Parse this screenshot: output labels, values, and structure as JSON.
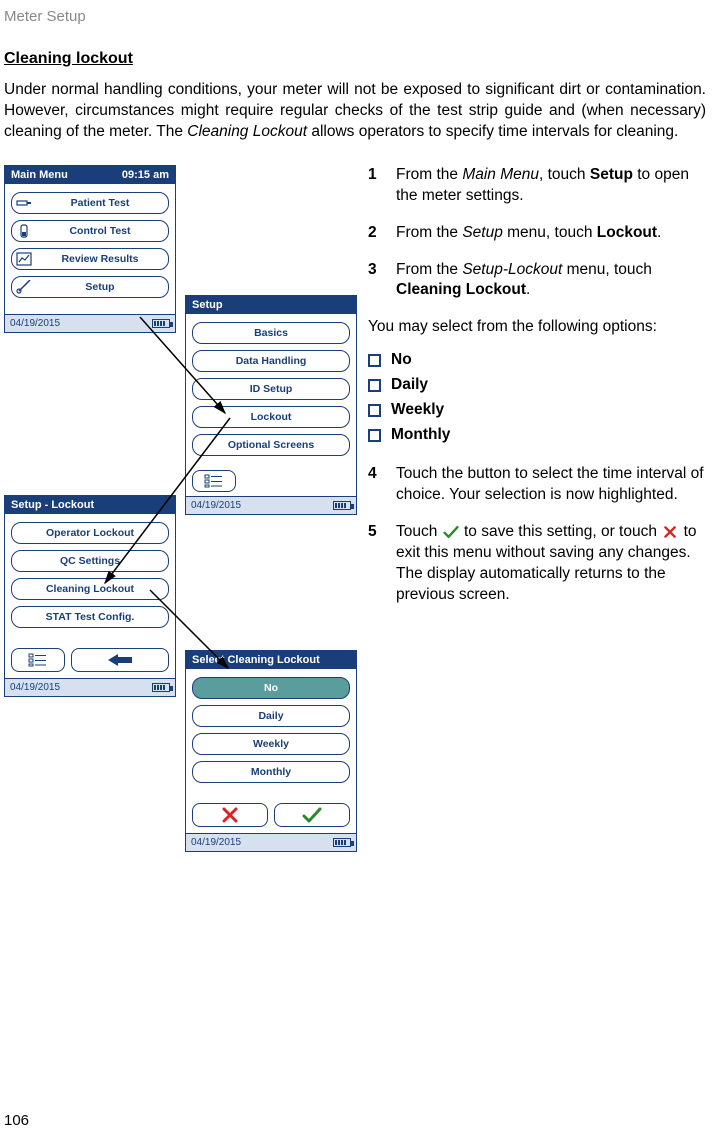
{
  "header": "Meter Setup",
  "section_title": "Cleaning lockout",
  "intro_html": "Under normal handling conditions, your meter will not be exposed to significant dirt or contamination. However, circumstances might require regular checks of the test strip guide and (when necessary) cleaning of the meter. The <em>Cleaning Lockout</em> allows operators to specify time intervals for cleaning.",
  "steps": [
    {
      "num": "1",
      "html": "From the <em>Main Menu</em>, touch <b>Setup</b> to open the meter settings."
    },
    {
      "num": "2",
      "html": "From the <em>Setup</em> menu, touch <b>Lockout</b>."
    },
    {
      "num": "3",
      "html": "From the <em>Setup-Lockout</em> menu, touch <b>Cleaning Lockout</b>."
    }
  ],
  "options_intro": "You may select from the following options:",
  "options": [
    "No",
    "Daily",
    "Weekly",
    "Monthly"
  ],
  "steps2": [
    {
      "num": "4",
      "html": "Touch the button to select the time interval of choice. Your selection is now highlighted."
    },
    {
      "num": "5",
      "html_pre": "Touch ",
      "html_mid": " to save this setting, or touch ",
      "html_post": " to exit this menu without saving any changes. The display automatically returns to the previous screen."
    }
  ],
  "screens": {
    "main": {
      "title": "Main Menu",
      "time": "09:15 am",
      "buttons": [
        "Patient Test",
        "Control Test",
        "Review Results",
        "Setup"
      ],
      "date": "04/19/2015"
    },
    "setup": {
      "title": "Setup",
      "buttons": [
        "Basics",
        "Data Handling",
        "ID Setup",
        "Lockout",
        "Optional Screens"
      ],
      "date": "04/19/2015"
    },
    "lockout": {
      "title": "Setup - Lockout",
      "buttons": [
        "Operator Lockout",
        "QC Settings",
        "Cleaning Lockout",
        "STAT Test Config."
      ],
      "date": "04/19/2015"
    },
    "cleaning": {
      "title": "Select Cleaning Lockout",
      "buttons": [
        "No",
        "Daily",
        "Weekly",
        "Monthly"
      ],
      "selected": "No",
      "date": "04/19/2015"
    }
  },
  "page_number": "106"
}
